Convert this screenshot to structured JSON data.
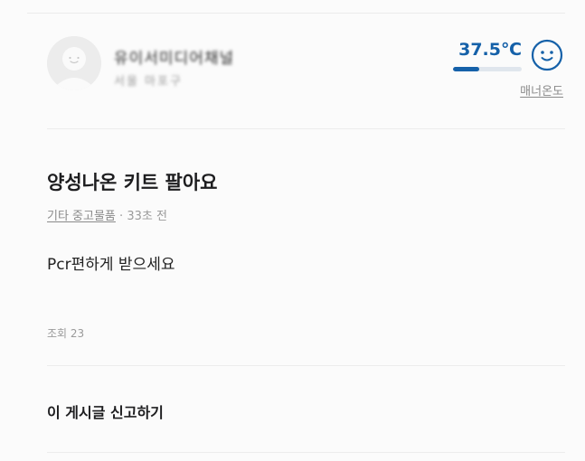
{
  "seller": {
    "nickname": "유이서미디어채널",
    "region": "서울 마포구",
    "manner_temperature": "37.5℃",
    "manner_temperature_level": 0.375,
    "manner_label": "매너온도",
    "face_icon": "smile-face-icon",
    "avatar_icon": "default-profile-avatar"
  },
  "post": {
    "title": "양성나온 키트 팔아요",
    "category": "기타 중고물품",
    "separator": " · ",
    "time_ago": "33초 전",
    "content": "Pcr편하게 받으세요",
    "views": "조회 23"
  },
  "actions": {
    "report": "이 게시글 신고하기"
  },
  "colors": {
    "accent": "#1561a9",
    "muted_text": "#9a9a9a",
    "divider": "#ececec"
  }
}
